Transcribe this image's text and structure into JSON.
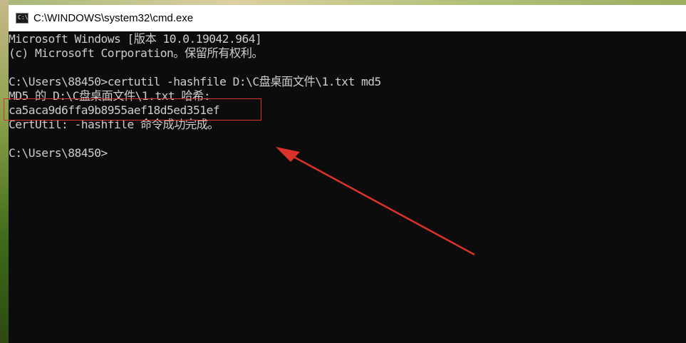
{
  "window": {
    "title": "C:\\WINDOWS\\system32\\cmd.exe",
    "icon": "cmd-window-icon"
  },
  "console": {
    "lines": [
      "Microsoft Windows [版本 10.0.19042.964]",
      "(c) Microsoft Corporation。保留所有权利。",
      "",
      "C:\\Users\\88450>certutil -hashfile D:\\C盘桌面文件\\1.txt md5",
      "MD5 的 D:\\C盘桌面文件\\1.txt 哈希:",
      "ca5aca9d6ffa9b8955aef18d5ed351ef",
      "CertUtil: -hashfile 命令成功完成。",
      "",
      "C:\\Users\\88450>"
    ]
  },
  "annotations": {
    "color": "#d9332a"
  }
}
